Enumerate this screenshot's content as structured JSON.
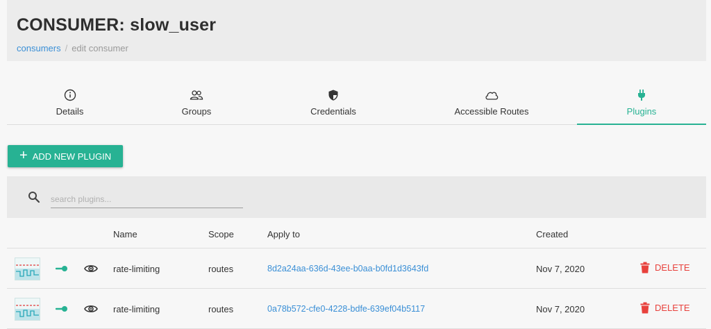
{
  "header": {
    "title": "CONSUMER: slow_user",
    "breadcrumb": {
      "link": "consumers",
      "separator": "/",
      "current": "edit consumer"
    }
  },
  "tabs": [
    {
      "label": "Details",
      "icon": "info-icon"
    },
    {
      "label": "Groups",
      "icon": "users-icon"
    },
    {
      "label": "Credentials",
      "icon": "shield-icon"
    },
    {
      "label": "Accessible Routes",
      "icon": "cloud-icon"
    },
    {
      "label": "Plugins",
      "icon": "plug-icon",
      "active": true
    }
  ],
  "actions": {
    "add_label": "ADD NEW PLUGIN"
  },
  "search": {
    "placeholder": "search plugins..."
  },
  "table": {
    "headers": {
      "name": "Name",
      "scope": "Scope",
      "apply_to": "Apply to",
      "created": "Created"
    },
    "rows": [
      {
        "name": "rate-limiting",
        "scope": "routes",
        "apply_to": "8d2a24aa-636d-43ee-b0aa-b0fd1d3643fd",
        "created": "Nov 7, 2020",
        "delete_label": "DELETE"
      },
      {
        "name": "rate-limiting",
        "scope": "routes",
        "apply_to": "0a78b572-cfe0-4228-bdfe-639ef04b5117",
        "created": "Nov 7, 2020",
        "delete_label": "DELETE"
      }
    ]
  },
  "colors": {
    "accent": "#27b293",
    "link": "#3a8fd6",
    "danger": "#e8413c"
  }
}
